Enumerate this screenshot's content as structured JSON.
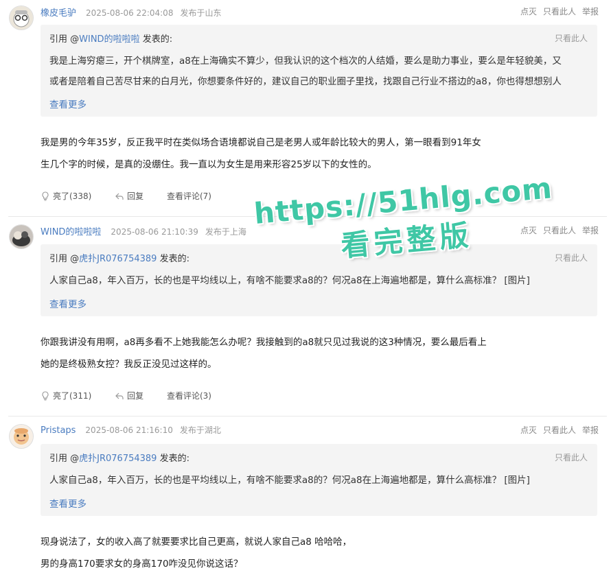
{
  "posts": [
    {
      "username": "橡皮毛驴",
      "time": "2025-08-06 22:04:08",
      "location": "发布于山东",
      "ops": {
        "dislike": "点灭",
        "only_this": "只看此人",
        "report": "举报"
      },
      "quote": {
        "prefix": "引用 @",
        "name": "WIND的啦啦啦",
        "suffix": " 发表的:",
        "only_this": "只看此人",
        "lines": [
          "我是上海穷瘪三，开个棋牌室，a8在上海确实不算少，但我认识的这个档次的人结婚，要么是助力事业，要么是年轻貌美，又",
          "或者是陪着自己苦尽甘来的白月光，你想要条件好的，建议自己的职业圈子里找，找跟自己行业不搭边的a8，你也得想想别人"
        ],
        "more": "查看更多"
      },
      "body": [
        "我是男的今年35岁，反正我平时在类似场合语境都说自己是老男人或年龄比较大的男人，第一眼看到91年女",
        "生几个字的时候，是真的没绷住。我一直以为女生是用来形容25岁以下的女性的。"
      ],
      "actions": {
        "like": "亮了(338)",
        "reply": "回复",
        "view": "查看评论(7)"
      }
    },
    {
      "username": "WIND的啦啦啦",
      "time": "2025-08-06 21:10:39",
      "location": "发布于上海",
      "ops": {
        "dislike": "点灭",
        "only_this": "只看此人",
        "report": "举报"
      },
      "quote": {
        "prefix": "引用 @",
        "name": "虎扑JR076754389",
        "suffix": " 发表的:",
        "only_this": "只看此人",
        "lines": [
          "人家自己a8，年入百万，长的也是平均线以上，有啥不能要求a8的？何况a8在上海遍地都是，算什么高标准？ [图片]"
        ],
        "more": "查看更多"
      },
      "body": [
        "你跟我讲没有用啊，a8再多看不上她我能怎么办呢？我接触到的a8就只见过我说的这3种情况，要么最后看上",
        "她的是终极熟女控？我反正没见过这样的。"
      ],
      "actions": {
        "like": "亮了(311)",
        "reply": "回复",
        "view": "查看评论(3)"
      }
    },
    {
      "username": "Pristaps",
      "time": "2025-08-06 21:16:10",
      "location": "发布于湖北",
      "ops": {
        "dislike": "点灭",
        "only_this": "只看此人",
        "report": "举报"
      },
      "quote": {
        "prefix": "引用 @",
        "name": "虎扑JR076754389",
        "suffix": " 发表的:",
        "only_this": "只看此人",
        "lines": [
          "人家自己a8，年入百万，长的也是平均线以上，有啥不能要求a8的？何况a8在上海遍地都是，算什么高标准？ [图片]"
        ],
        "more": "查看更多"
      },
      "body": [
        "现身说法了，女的收入高了就要要求比自己更高，就说人家自己a8 哈哈哈，",
        "男的身高170要求女的身高170咋没见你说这话？"
      ]
    }
  ],
  "watermark": {
    "line1": "https://51hlg.com",
    "line2": "看完整版"
  },
  "colors": {
    "link": "#4a7cc0",
    "quote_bg": "#f4f4f4",
    "watermark": "#3fc7a5"
  }
}
